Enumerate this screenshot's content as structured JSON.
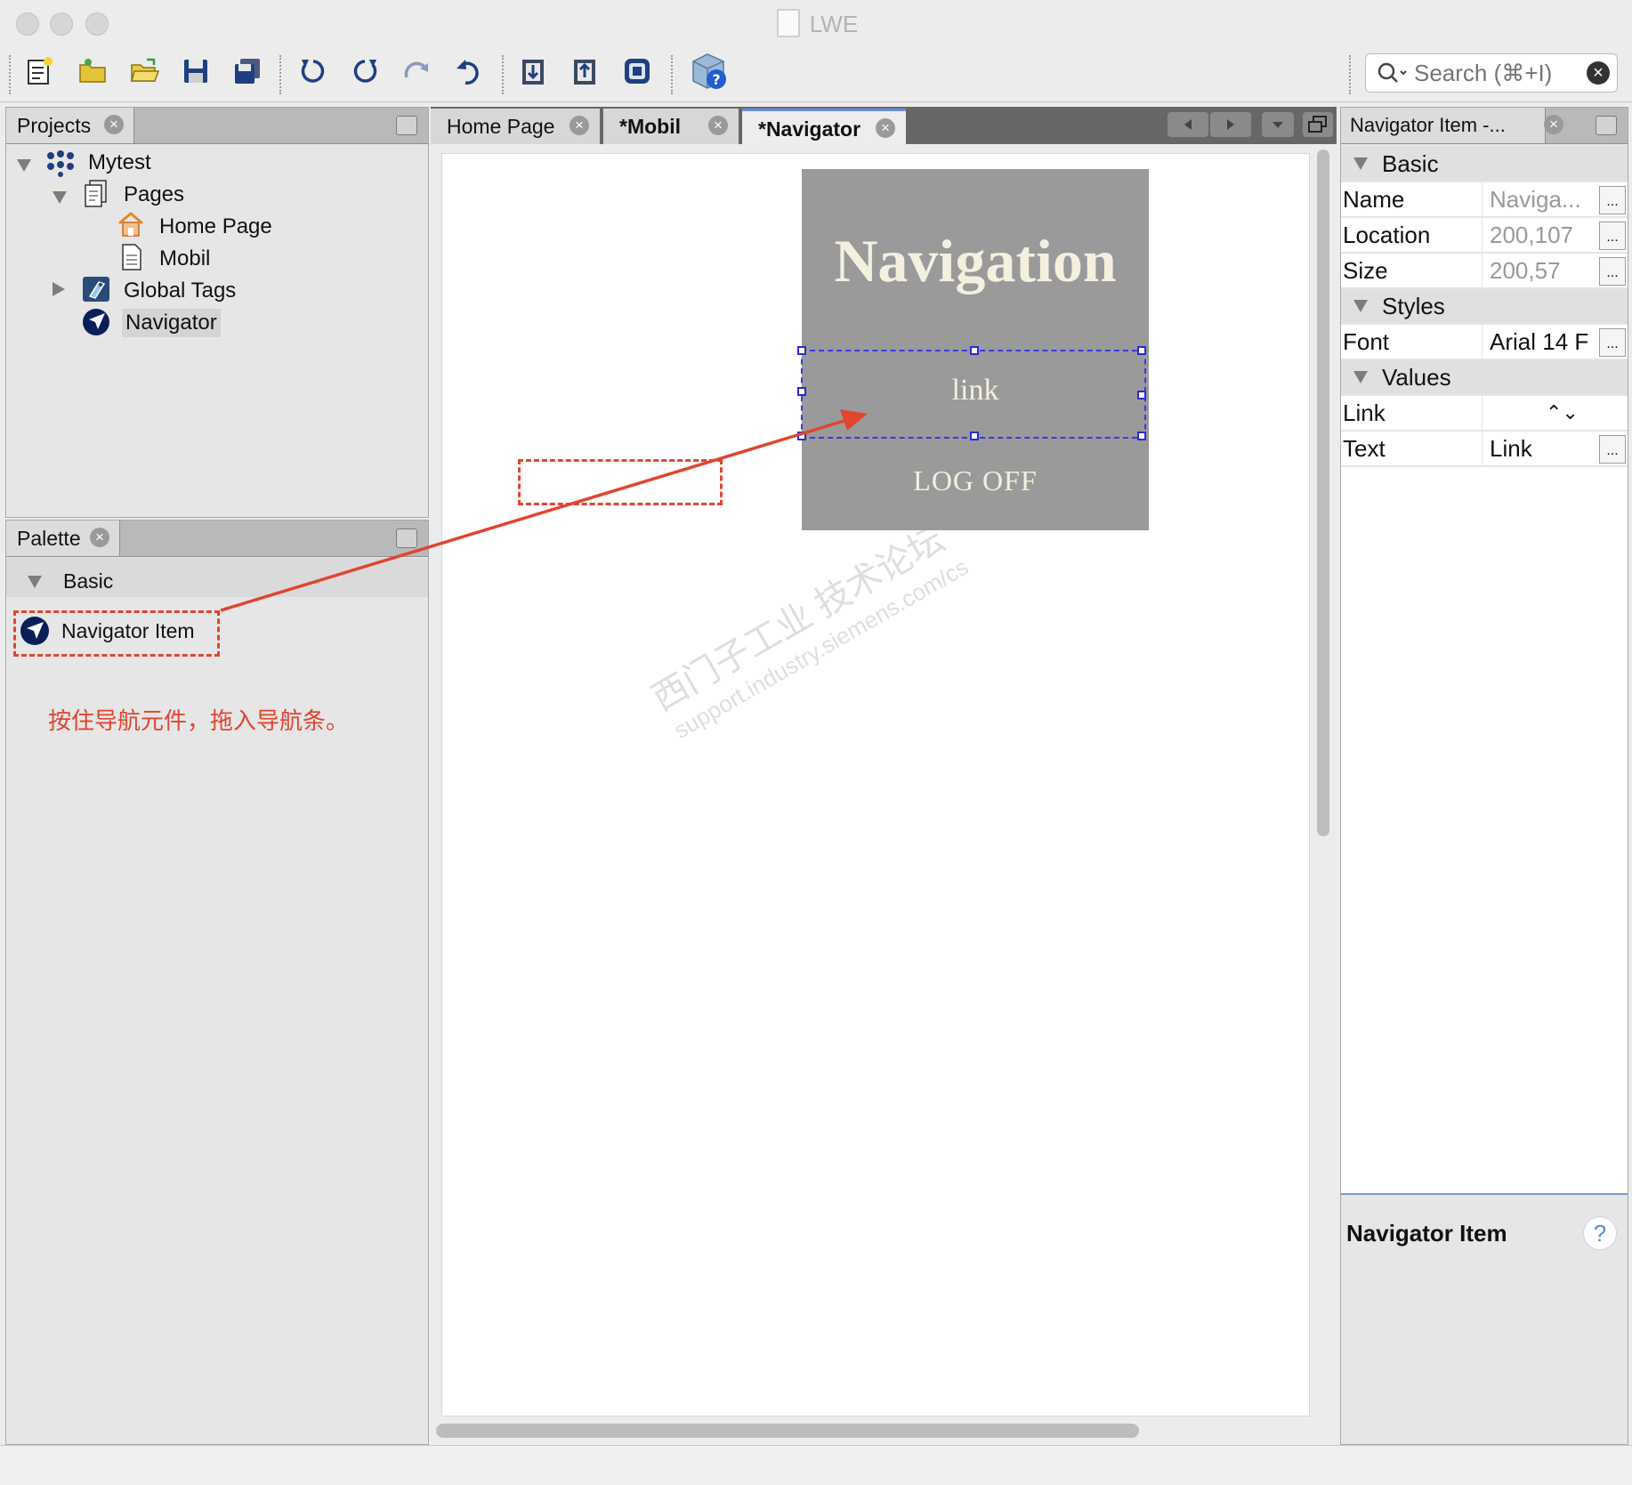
{
  "window": {
    "title": "LWE"
  },
  "search": {
    "placeholder": "Search (⌘+I)"
  },
  "projects_panel": {
    "tab_label": "Projects",
    "tree": {
      "root": "Mytest",
      "pages": "Pages",
      "home_page": "Home Page",
      "mobil": "Mobil",
      "global_tags": "Global Tags",
      "navigator": "Navigator"
    }
  },
  "palette_panel": {
    "tab_label": "Palette",
    "section": "Basic",
    "item": "Navigator Item",
    "instruction": "按住导航元件，拖入导航条。"
  },
  "editor": {
    "tabs": [
      {
        "label": "Home Page",
        "active": false
      },
      {
        "label": "*Mobil",
        "active": false
      },
      {
        "label": "*Navigator",
        "active": true
      }
    ],
    "nav_title": "Navigation",
    "nav_link": "link",
    "nav_logoff": "LOG OFF",
    "watermark_main": "西门子工业 技术论坛",
    "watermark_url": "support.industry.siemens.com/cs"
  },
  "properties_panel": {
    "tab_label": "Navigator Item -...",
    "sections": {
      "basic": "Basic",
      "styles": "Styles",
      "values": "Values"
    },
    "rows": {
      "name": {
        "label": "Name",
        "value": "Naviga..."
      },
      "location": {
        "label": "Location",
        "value": "200,107"
      },
      "size": {
        "label": "Size",
        "value": "200,57"
      },
      "font": {
        "label": "Font",
        "value": "Arial 14 F"
      },
      "link": {
        "label": "Link",
        "value": ""
      },
      "text": {
        "label": "Text",
        "value": "Link"
      }
    },
    "button_label": "...",
    "spinner_glyph": "⌃⌄",
    "help_title": "Navigator Item",
    "help_icon": "?"
  },
  "colors": {
    "annotation": "#e04530",
    "selection": "#2a2ad8",
    "nav_bg": "#9a9a9a"
  }
}
